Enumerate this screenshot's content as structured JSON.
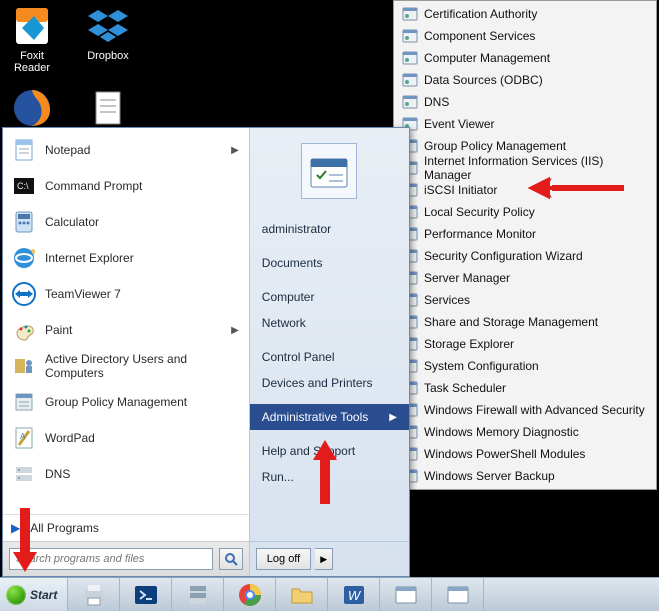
{
  "desktop_icons": {
    "foxit": "Foxit Reader",
    "dropbox": "Dropbox"
  },
  "start_menu": {
    "programs": [
      {
        "label": "Notepad",
        "expand": true,
        "icon": "notepad"
      },
      {
        "label": "Command Prompt",
        "expand": false,
        "icon": "cmd"
      },
      {
        "label": "Calculator",
        "expand": false,
        "icon": "calc"
      },
      {
        "label": "Internet Explorer",
        "expand": false,
        "icon": "ie"
      },
      {
        "label": "TeamViewer 7",
        "expand": false,
        "icon": "teamviewer"
      },
      {
        "label": "Paint",
        "expand": true,
        "icon": "paint"
      },
      {
        "label": "Active Directory Users and Computers",
        "expand": false,
        "icon": "aduc"
      },
      {
        "label": "Group Policy Management",
        "expand": false,
        "icon": "gpm"
      },
      {
        "label": "WordPad",
        "expand": false,
        "icon": "wordpad"
      },
      {
        "label": "DNS",
        "expand": false,
        "icon": "dns"
      }
    ],
    "all_programs": "All Programs",
    "search_placeholder": "Search programs and files"
  },
  "start_right": {
    "user": "administrator",
    "items": [
      {
        "label": "Documents",
        "selected": false
      },
      {
        "label": "Computer",
        "selected": false
      },
      {
        "label": "Network",
        "selected": false
      },
      {
        "label": "Control Panel",
        "selected": false
      },
      {
        "label": "Devices and Printers",
        "selected": false
      },
      {
        "label": "Administrative Tools",
        "selected": true,
        "arrow": true
      },
      {
        "label": "Help and Support",
        "selected": false
      },
      {
        "label": "Run...",
        "selected": false
      }
    ],
    "logoff_label": "Log off"
  },
  "admin_tools": [
    "Certification Authority",
    "Component Services",
    "Computer Management",
    "Data Sources (ODBC)",
    "DNS",
    "Event Viewer",
    "Group Policy Management",
    "Internet Information Services (IIS) Manager",
    "iSCSI Initiator",
    "Local Security Policy",
    "Performance Monitor",
    "Security Configuration Wizard",
    "Server Manager",
    "Services",
    "Share and Storage Management",
    "Storage Explorer",
    "System Configuration",
    "Task Scheduler",
    "Windows Firewall with Advanced Security",
    "Windows Memory Diagnostic",
    "Windows PowerShell Modules",
    "Windows Server Backup"
  ],
  "taskbar": {
    "start_label": "Start"
  }
}
